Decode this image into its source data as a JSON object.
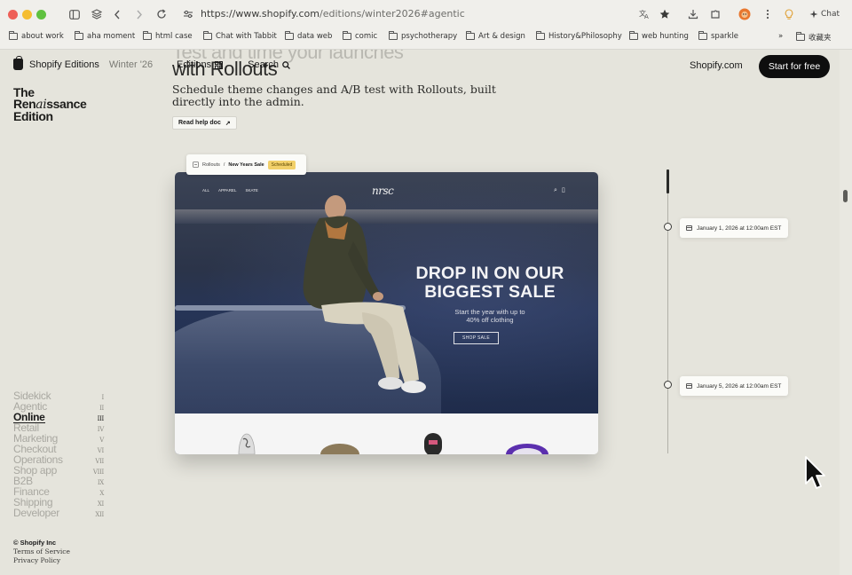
{
  "browser": {
    "url_host": "https://www.shopify.com",
    "url_path": "/editions/winter2026#agentic",
    "chat_label": "Chat",
    "bookmarks": [
      "about work",
      "aha moment",
      "html case",
      "Chat with Tabbit",
      "data web",
      "comic",
      "psychotherapy",
      "Art & design",
      "History&Philosophy",
      "web hunting",
      "sparkle",
      "收藏夹"
    ],
    "overflow_label": "»"
  },
  "header": {
    "brand": "Shopify Editions",
    "edition": "Winter '26",
    "nav_editions": "Editions",
    "nav_search": "Search",
    "shopify_link": "Shopify.com",
    "cta": "Start for free"
  },
  "hero": {
    "ghost_line": "Test and time your launches",
    "title": "with Rollouts",
    "subtitle": "Schedule theme changes and A/B test with Rollouts, built directly into the admin.",
    "help_button": "Read help doc",
    "help_arrow": "↗"
  },
  "edition_title": {
    "line1": "The",
    "line2_pre": "Ren",
    "line2_ital": "ai",
    "line2_post": "ssance",
    "line3": "Edition"
  },
  "sidebar": {
    "items": [
      {
        "label": "Sidekick",
        "num": "I"
      },
      {
        "label": "Agentic",
        "num": "II"
      },
      {
        "label": "Online",
        "num": "III"
      },
      {
        "label": "Retail",
        "num": "IV"
      },
      {
        "label": "Marketing",
        "num": "V"
      },
      {
        "label": "Checkout",
        "num": "VI"
      },
      {
        "label": "Operations",
        "num": "VII"
      },
      {
        "label": "Shop app",
        "num": "VIII"
      },
      {
        "label": "B2B",
        "num": "IX"
      },
      {
        "label": "Finance",
        "num": "X"
      },
      {
        "label": "Shipping",
        "num": "XI"
      },
      {
        "label": "Developer",
        "num": "XII"
      }
    ],
    "active_index": 2
  },
  "footer": {
    "copyright": "© Shopify Inc",
    "terms": "Terms of Service",
    "privacy": "Privacy Policy"
  },
  "rollout_pill": {
    "crumb": "Rollouts",
    "sep": "/",
    "name": "New Years Sale",
    "status": "Scheduled"
  },
  "mockup": {
    "nav_links": [
      "ALL",
      "APPAREL",
      "SKATE"
    ],
    "logo": "nrsc",
    "headline_line1": "DROP IN ON OUR",
    "headline_line2": "BIGGEST SALE",
    "subhead_line1": "Start the year with up to",
    "subhead_line2": "40% off clothing",
    "cta": "SHOP SALE"
  },
  "timeline": {
    "dates": [
      "January 1, 2026 at 12:00am EST",
      "January 5, 2026 at 12:00am EST"
    ]
  }
}
